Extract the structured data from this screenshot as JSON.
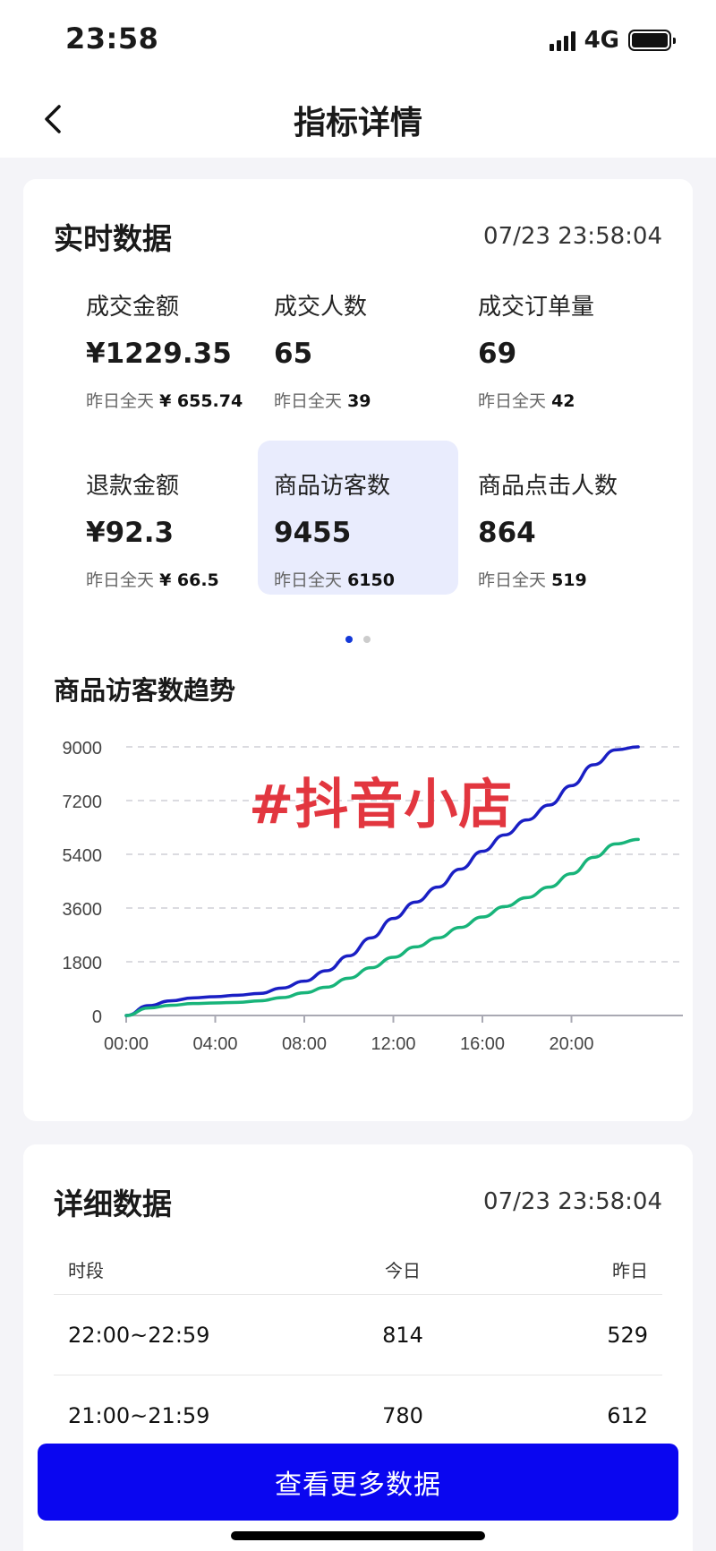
{
  "status": {
    "time": "23:58",
    "network": "4G"
  },
  "nav": {
    "title": "指标详情"
  },
  "realtime": {
    "title": "实时数据",
    "timestamp": "07/23 23:58:04",
    "prev_prefix": "昨日全天",
    "metrics": [
      {
        "label": "成交金额",
        "value": "¥1229.35",
        "prev": "¥ 655.74",
        "active": false
      },
      {
        "label": "成交人数",
        "value": "65",
        "prev": "39",
        "active": false
      },
      {
        "label": "成交订单量",
        "value": "69",
        "prev": "42",
        "active": false
      },
      {
        "label": "退款金额",
        "value": "¥92.3",
        "prev": "¥ 66.5",
        "active": false
      },
      {
        "label": "商品访客数",
        "value": "9455",
        "prev": "6150",
        "active": true
      },
      {
        "label": "商品点击人数",
        "value": "864",
        "prev": "519",
        "active": false
      }
    ],
    "page_dots": {
      "total": 2,
      "current": 0
    }
  },
  "trend": {
    "title": "商品访客数趋势"
  },
  "watermark": "#抖音小店",
  "chart_data": {
    "type": "line",
    "x": [
      0,
      1,
      2,
      3,
      4,
      5,
      6,
      7,
      8,
      9,
      10,
      11,
      12,
      13,
      14,
      15,
      16,
      17,
      18,
      19,
      20,
      21,
      22,
      23
    ],
    "x_ticks": [
      "00:00",
      "04:00",
      "08:00",
      "12:00",
      "16:00",
      "20:00"
    ],
    "x_tick_values": [
      0,
      4,
      8,
      12,
      16,
      20
    ],
    "y_ticks": [
      "0",
      "1800",
      "3600",
      "5400",
      "7200",
      "9000"
    ],
    "ylim": [
      0,
      9000
    ],
    "xlim": [
      0,
      24
    ],
    "grid": true,
    "series": [
      {
        "color": "#1a1fc4",
        "values": [
          0,
          330,
          490,
          590,
          630,
          680,
          740,
          920,
          1150,
          1500,
          2000,
          2600,
          3250,
          3800,
          4300,
          4900,
          5500,
          6050,
          6550,
          7050,
          7700,
          8400,
          8900,
          9000
        ]
      },
      {
        "color": "#18b47a",
        "values": [
          0,
          250,
          340,
          400,
          420,
          440,
          490,
          600,
          760,
          950,
          1250,
          1600,
          1950,
          2300,
          2600,
          2950,
          3300,
          3650,
          3950,
          4300,
          4750,
          5300,
          5750,
          5900
        ]
      }
    ]
  },
  "detail": {
    "title": "详细数据",
    "timestamp": "07/23 23:58:04",
    "columns": [
      "时段",
      "今日",
      "昨日"
    ],
    "rows": [
      {
        "period": "22:00~22:59",
        "today": "814",
        "yesterday": "529"
      },
      {
        "period": "21:00~21:59",
        "today": "780",
        "yesterday": "612"
      }
    ]
  },
  "button": {
    "label": "查看更多数据"
  }
}
